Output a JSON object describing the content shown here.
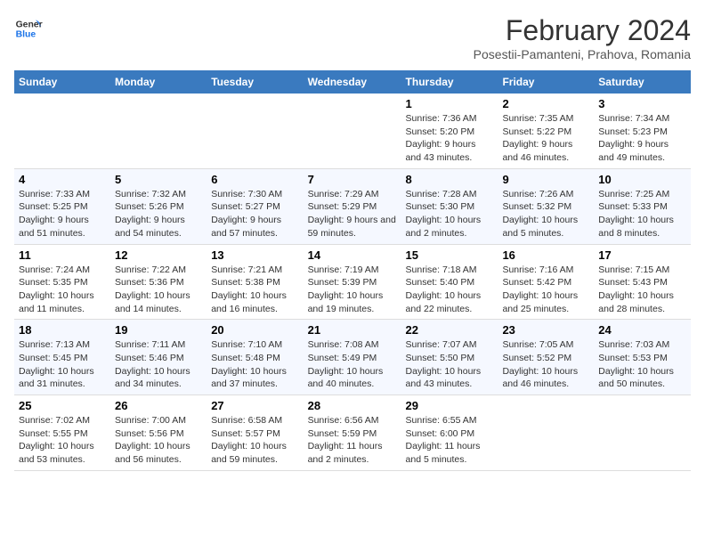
{
  "logo": {
    "line1": "General",
    "line2": "Blue"
  },
  "title": "February 2024",
  "subtitle": "Posestii-Pamanteni, Prahova, Romania",
  "days_of_week": [
    "Sunday",
    "Monday",
    "Tuesday",
    "Wednesday",
    "Thursday",
    "Friday",
    "Saturday"
  ],
  "weeks": [
    [
      {
        "num": "",
        "info": ""
      },
      {
        "num": "",
        "info": ""
      },
      {
        "num": "",
        "info": ""
      },
      {
        "num": "",
        "info": ""
      },
      {
        "num": "1",
        "info": "Sunrise: 7:36 AM\nSunset: 5:20 PM\nDaylight: 9 hours and 43 minutes."
      },
      {
        "num": "2",
        "info": "Sunrise: 7:35 AM\nSunset: 5:22 PM\nDaylight: 9 hours and 46 minutes."
      },
      {
        "num": "3",
        "info": "Sunrise: 7:34 AM\nSunset: 5:23 PM\nDaylight: 9 hours and 49 minutes."
      }
    ],
    [
      {
        "num": "4",
        "info": "Sunrise: 7:33 AM\nSunset: 5:25 PM\nDaylight: 9 hours and 51 minutes."
      },
      {
        "num": "5",
        "info": "Sunrise: 7:32 AM\nSunset: 5:26 PM\nDaylight: 9 hours and 54 minutes."
      },
      {
        "num": "6",
        "info": "Sunrise: 7:30 AM\nSunset: 5:27 PM\nDaylight: 9 hours and 57 minutes."
      },
      {
        "num": "7",
        "info": "Sunrise: 7:29 AM\nSunset: 5:29 PM\nDaylight: 9 hours and 59 minutes."
      },
      {
        "num": "8",
        "info": "Sunrise: 7:28 AM\nSunset: 5:30 PM\nDaylight: 10 hours and 2 minutes."
      },
      {
        "num": "9",
        "info": "Sunrise: 7:26 AM\nSunset: 5:32 PM\nDaylight: 10 hours and 5 minutes."
      },
      {
        "num": "10",
        "info": "Sunrise: 7:25 AM\nSunset: 5:33 PM\nDaylight: 10 hours and 8 minutes."
      }
    ],
    [
      {
        "num": "11",
        "info": "Sunrise: 7:24 AM\nSunset: 5:35 PM\nDaylight: 10 hours and 11 minutes."
      },
      {
        "num": "12",
        "info": "Sunrise: 7:22 AM\nSunset: 5:36 PM\nDaylight: 10 hours and 14 minutes."
      },
      {
        "num": "13",
        "info": "Sunrise: 7:21 AM\nSunset: 5:38 PM\nDaylight: 10 hours and 16 minutes."
      },
      {
        "num": "14",
        "info": "Sunrise: 7:19 AM\nSunset: 5:39 PM\nDaylight: 10 hours and 19 minutes."
      },
      {
        "num": "15",
        "info": "Sunrise: 7:18 AM\nSunset: 5:40 PM\nDaylight: 10 hours and 22 minutes."
      },
      {
        "num": "16",
        "info": "Sunrise: 7:16 AM\nSunset: 5:42 PM\nDaylight: 10 hours and 25 minutes."
      },
      {
        "num": "17",
        "info": "Sunrise: 7:15 AM\nSunset: 5:43 PM\nDaylight: 10 hours and 28 minutes."
      }
    ],
    [
      {
        "num": "18",
        "info": "Sunrise: 7:13 AM\nSunset: 5:45 PM\nDaylight: 10 hours and 31 minutes."
      },
      {
        "num": "19",
        "info": "Sunrise: 7:11 AM\nSunset: 5:46 PM\nDaylight: 10 hours and 34 minutes."
      },
      {
        "num": "20",
        "info": "Sunrise: 7:10 AM\nSunset: 5:48 PM\nDaylight: 10 hours and 37 minutes."
      },
      {
        "num": "21",
        "info": "Sunrise: 7:08 AM\nSunset: 5:49 PM\nDaylight: 10 hours and 40 minutes."
      },
      {
        "num": "22",
        "info": "Sunrise: 7:07 AM\nSunset: 5:50 PM\nDaylight: 10 hours and 43 minutes."
      },
      {
        "num": "23",
        "info": "Sunrise: 7:05 AM\nSunset: 5:52 PM\nDaylight: 10 hours and 46 minutes."
      },
      {
        "num": "24",
        "info": "Sunrise: 7:03 AM\nSunset: 5:53 PM\nDaylight: 10 hours and 50 minutes."
      }
    ],
    [
      {
        "num": "25",
        "info": "Sunrise: 7:02 AM\nSunset: 5:55 PM\nDaylight: 10 hours and 53 minutes."
      },
      {
        "num": "26",
        "info": "Sunrise: 7:00 AM\nSunset: 5:56 PM\nDaylight: 10 hours and 56 minutes."
      },
      {
        "num": "27",
        "info": "Sunrise: 6:58 AM\nSunset: 5:57 PM\nDaylight: 10 hours and 59 minutes."
      },
      {
        "num": "28",
        "info": "Sunrise: 6:56 AM\nSunset: 5:59 PM\nDaylight: 11 hours and 2 minutes."
      },
      {
        "num": "29",
        "info": "Sunrise: 6:55 AM\nSunset: 6:00 PM\nDaylight: 11 hours and 5 minutes."
      },
      {
        "num": "",
        "info": ""
      },
      {
        "num": "",
        "info": ""
      }
    ]
  ]
}
